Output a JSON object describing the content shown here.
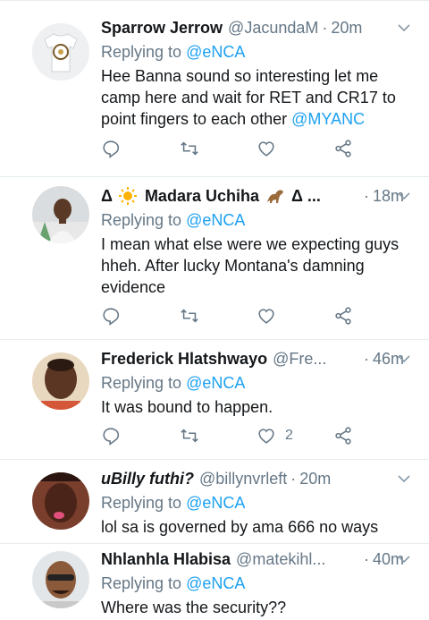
{
  "tweets": [
    {
      "name": "Sparrow Jerrow",
      "handle": "@JacundaM",
      "time": "20m",
      "replying_prefix": "Replying to ",
      "replying_to": "@eNCA",
      "text": "Hee Banna sound so interesting let me camp here and wait for RET and CR17 to point fingers to each other ",
      "mention": "@MYANC",
      "like_count": ""
    },
    {
      "name_prefix": "Δ",
      "name": "Madara Uchiha",
      "name_suffix": "Δ ...",
      "handle": "",
      "time": "18m",
      "replying_prefix": "Replying to ",
      "replying_to": "@eNCA",
      "text": "I mean what else were we expecting guys hheh. After lucky Montana's damning evidence",
      "like_count": ""
    },
    {
      "name": "Frederick Hlatshwayo",
      "handle": "@Fre...",
      "time": "46m",
      "replying_prefix": "Replying to ",
      "replying_to": "@eNCA",
      "text": "It was bound to happen.",
      "like_count": "2"
    },
    {
      "name": "uBilly futhi?",
      "handle": "@billynvrleft",
      "time": "20m",
      "replying_prefix": "Replying to ",
      "replying_to": "@eNCA",
      "text": "lol sa is governed by ama 666 no ways",
      "like_count": ""
    },
    {
      "name": "Nhlanhla Hlabisa",
      "handle": "@matekihl...",
      "time": "40m",
      "replying_prefix": "Replying to ",
      "replying_to": "@eNCA",
      "text": "Where was the security??",
      "like_count": ""
    }
  ],
  "icons": {
    "reply": "reply-icon",
    "retweet": "retweet-icon",
    "like": "like-icon",
    "share": "share-icon",
    "more": "chevron-down-icon"
  },
  "colors": {
    "link": "#1da1f2",
    "muted": "#657786",
    "divider": "#e6ecf0"
  }
}
